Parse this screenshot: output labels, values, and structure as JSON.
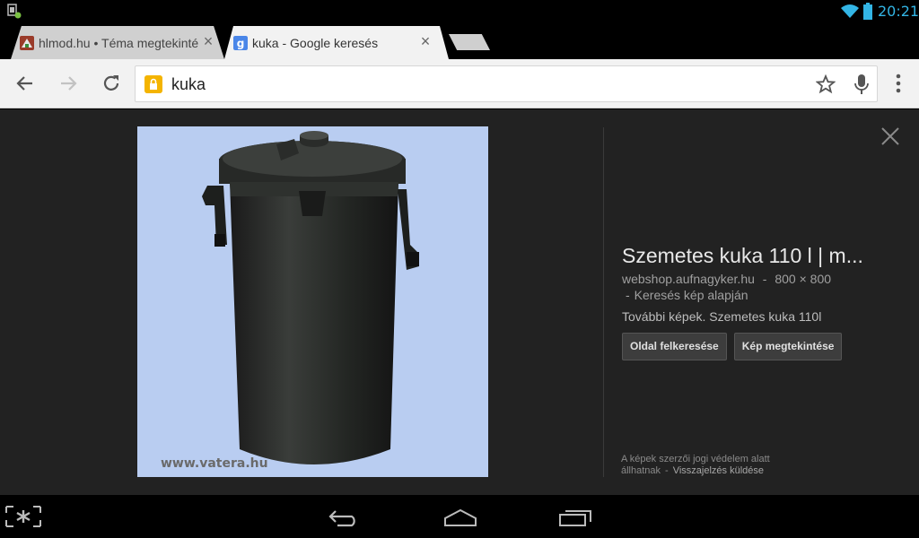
{
  "status_bar": {
    "time": "20:21",
    "icons": [
      "notification-icon",
      "wifi-icon",
      "battery-icon"
    ],
    "accent_color": "#33b5e5"
  },
  "tabs": [
    {
      "title": "hlmod.hu • Téma megtekintése",
      "favicon": "hlmod-favicon",
      "active": false,
      "close_label": "×"
    },
    {
      "title": "kuka - Google keresés",
      "favicon": "google-favicon",
      "active": true,
      "close_label": "×"
    }
  ],
  "toolbar": {
    "url": "kuka",
    "icons": [
      "back-arrow-icon",
      "forward-arrow-icon",
      "reload-icon",
      "lock-icon",
      "star-icon",
      "microphone-icon",
      "overflow-menu-icon"
    ]
  },
  "image_preview": {
    "watermark": "www.vatera.hu",
    "title": "Szemetes kuka 110 l | m...",
    "source_site": "webshop.aufnagyker.hu",
    "dimensions": "800 × 800",
    "search_by_image": "Keresés kép alapján",
    "more_images": "További képek. Szemetes kuka 110l",
    "visit_page_button": "Oldal felkeresése",
    "view_image_button": "Kép megtekintése",
    "copyright_line1": "A képek szerzői jogi védelem alatt",
    "copyright_line2": "állhatnak",
    "feedback_link": "Visszajelzés küldése"
  },
  "nav_bar": {
    "icons": [
      "screenshot-icon",
      "back-icon",
      "home-icon",
      "recent-apps-icon"
    ]
  }
}
